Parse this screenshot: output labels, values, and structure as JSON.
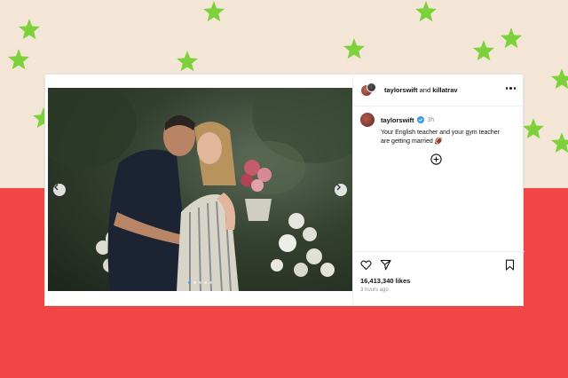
{
  "colors": {
    "background_top": "#f3e6d6",
    "background_bottom": "#f24646",
    "star": "#7dd23c",
    "verified": "#3897f0"
  },
  "post": {
    "header": {
      "owner_1": "taylorswift",
      "joiner": "and",
      "owner_2": "killatrav",
      "more_icon": "more-horizontal-icon"
    },
    "caption": {
      "username": "taylorswift",
      "time": "3h",
      "text": "Your English teacher and your gym teacher are getting married 🏈"
    },
    "carousel": {
      "slide_count": 5,
      "active_slide": 1,
      "prev_icon": "chevron-left-icon",
      "next_icon": "chevron-right-icon"
    },
    "actions": {
      "like_icon": "heart-icon",
      "share_icon": "send-icon",
      "save_icon": "bookmark-icon",
      "add_comment_icon": "plus-circle-icon"
    },
    "likes": "16,413,340 likes",
    "ago": "3 hours ago"
  }
}
